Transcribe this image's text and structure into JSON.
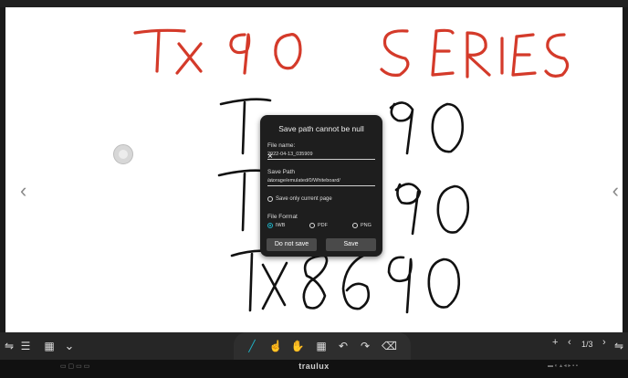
{
  "whiteboard": {
    "handwriting": [
      "TX 90 SERIES",
      "TX 65 90",
      "TX 75 90",
      "TX 86 90"
    ],
    "left_arrow": "‹",
    "right_arrow": "‹"
  },
  "dialog": {
    "title": "Save path cannot be null",
    "file_name_label": "File name:",
    "file_name_value": "2022-04-13_035909",
    "save_path_label": "Save Path",
    "save_path_value": "/storage/emulated/0/Whiteboard/",
    "save_only_current_label": "Save only current page",
    "file_format_label": "File Format",
    "formats": [
      "IWB",
      "PDF",
      "PNG"
    ],
    "selected_format": "IWB",
    "cancel_label": "Do not save",
    "save_label": "Save"
  },
  "toolbar": {
    "page_indicator": "1/3",
    "add": "+",
    "prev": "‹",
    "next": "›",
    "chevron": "⌄"
  },
  "bottom_bar": {
    "brand": "traulux"
  },
  "colors": {
    "red_ink": "#d43a2a",
    "black_ink": "#111111",
    "accent": "#1fb3c8"
  }
}
